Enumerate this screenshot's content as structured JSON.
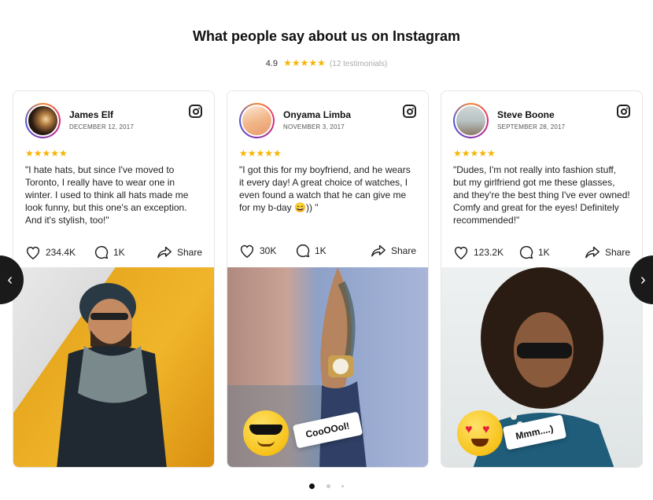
{
  "header": {
    "title": "What people say about us on Instagram",
    "rating": "4.9",
    "stars": "★★★★★",
    "testimonials": "(12 testimonials)"
  },
  "cards": [
    {
      "name": "James Elf",
      "date": "DECEMBER 12, 2017",
      "stars": "★★★★★",
      "review": "\"I hate hats, but since I've moved to Toronto, I really have to wear one in winter. I used to think all hats made me look funny, but this one's an exception. And it's stylish, too!\"",
      "likes": "234.4K",
      "comments": "1K",
      "share": "Share"
    },
    {
      "name": "Onyama Limba",
      "date": "NOVEMBER 3, 2017",
      "stars": "★★★★★",
      "review": "\"I got this for my boyfriend, and he wears it every day! A great choice of watches, I even found a watch that he can give me for my b-day 😄)) \"",
      "likes": "30K",
      "comments": "1K",
      "share": "Share",
      "sticker": "CooOOol!"
    },
    {
      "name": "Steve Boone",
      "date": "SEPTEMBER 28, 2017",
      "stars": "★★★★★",
      "review": "\"Dudes, I'm not really into fashion stuff, but my girlfriend got me these glasses, and they're the best thing I've ever owned! Comfy and great for the eyes! Definitely recommended!\"",
      "likes": "123.2K",
      "comments": "1K",
      "share": "Share",
      "sticker": "Mmm....)"
    }
  ],
  "nav": {
    "prev": "‹",
    "next": "›"
  },
  "pagination": {
    "pages": 3,
    "active": 1
  },
  "colors": {
    "star": "#f6b400",
    "nav": "#1a1a1a"
  }
}
